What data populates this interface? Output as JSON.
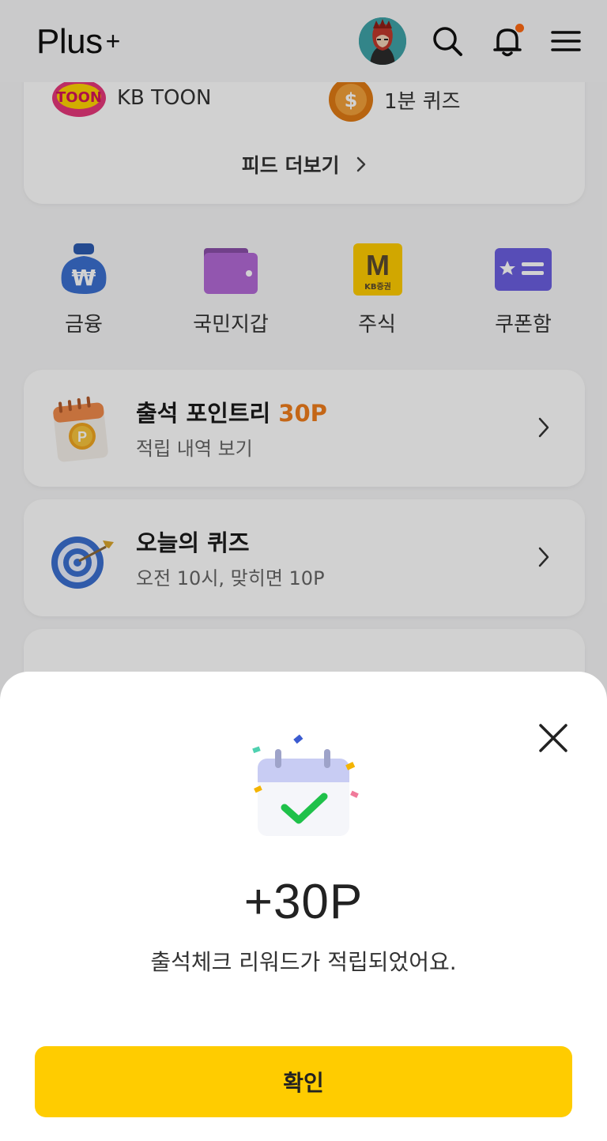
{
  "header": {
    "logo_text": "Plus",
    "logo_plus": "+",
    "has_notification": true
  },
  "feed": {
    "items": [
      {
        "label": "KB TOON",
        "icon": "kb-toon-logo"
      },
      {
        "label": "1분 퀴즈",
        "icon": "quiz-coin-icon"
      }
    ],
    "more_label": "피드 더보기"
  },
  "quick_menu": {
    "items": [
      {
        "label": "금융",
        "icon": "money-bag-icon"
      },
      {
        "label": "국민지갑",
        "icon": "wallet-icon"
      },
      {
        "label": "주식",
        "icon": "kb-securities-icon"
      },
      {
        "label": "쿠폰함",
        "icon": "coupon-icon"
      }
    ]
  },
  "attendance": {
    "title": "출석 포인트리",
    "points": "30P",
    "subtitle": "적립 내역 보기"
  },
  "quiz": {
    "title": "오늘의 퀴즈",
    "subtitle": "오전 10시, 맞히면 10P"
  },
  "sheet": {
    "points": "+30P",
    "message": "출석체크 리워드가 적립되었어요.",
    "confirm_label": "확인"
  },
  "colors": {
    "accent_yellow": "#ffcc00",
    "points_orange": "#ef7d1b",
    "check_green": "#22c55e",
    "notification_dot": "#ff6a13"
  }
}
